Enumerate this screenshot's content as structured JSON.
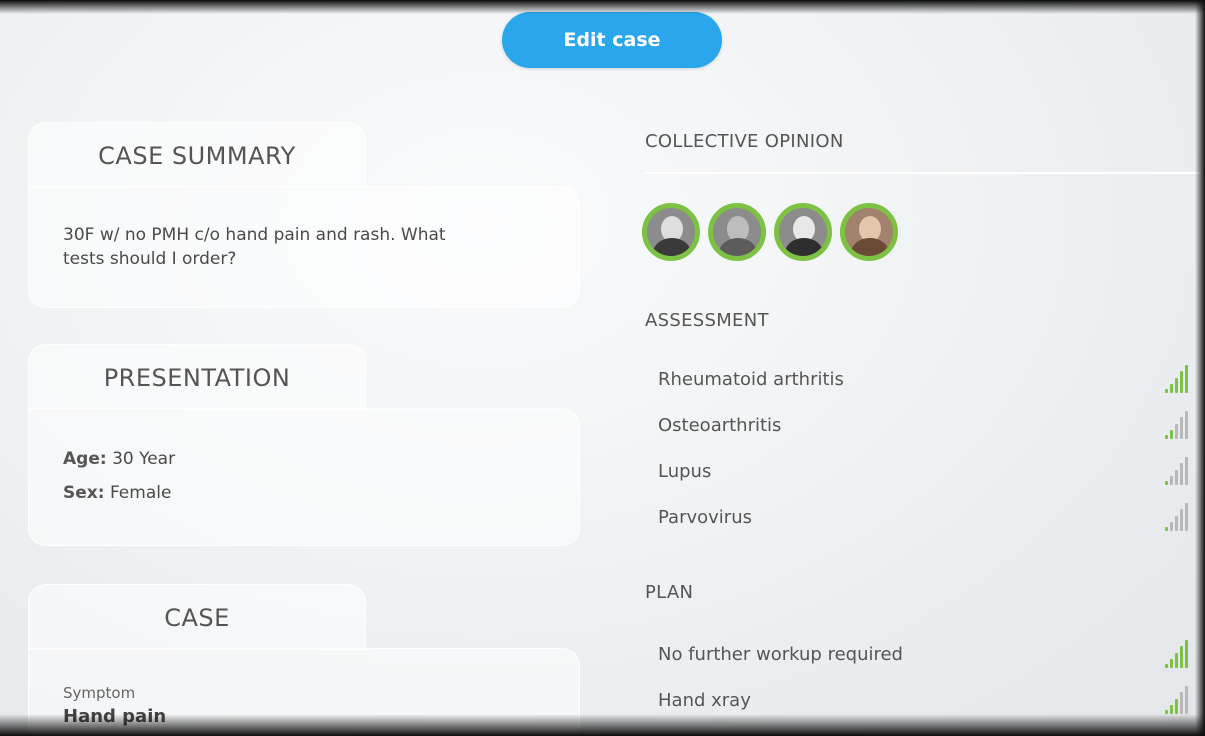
{
  "toolbar": {
    "edit_label": "Edit case"
  },
  "summary": {
    "title": "CASE SUMMARY",
    "text_line1": "30F w/ no PMH c/o hand pain and rash. What",
    "text_line2": "tests should I order?"
  },
  "presentation": {
    "title": "PRESENTATION",
    "age_label": "Age:",
    "age_value": "30 Year",
    "sex_label": "Sex:",
    "sex_value": "Female"
  },
  "case": {
    "title": "CASE",
    "symptom_label": "Symptom",
    "symptom_value": "Hand pain"
  },
  "opinion": {
    "title": "COLLECTIVE OPINION",
    "avatars": [
      "avatar-1",
      "avatar-2",
      "avatar-3",
      "avatar-4"
    ]
  },
  "assessment": {
    "title": "ASSESSMENT",
    "items": [
      {
        "label": "Rheumatoid arthritis",
        "strength": 5
      },
      {
        "label": "Osteoarthritis",
        "strength": 2
      },
      {
        "label": "Lupus",
        "strength": 1
      },
      {
        "label": "Parvovirus",
        "strength": 1
      }
    ]
  },
  "plan": {
    "title": "PLAN",
    "items": [
      {
        "label": "No further workup required",
        "strength": 5
      },
      {
        "label": "Hand xray",
        "strength": 3
      }
    ]
  },
  "colors": {
    "accent": "#2aa6ec",
    "signal_on": "#7dc242",
    "signal_off": "#b8b8b8"
  }
}
